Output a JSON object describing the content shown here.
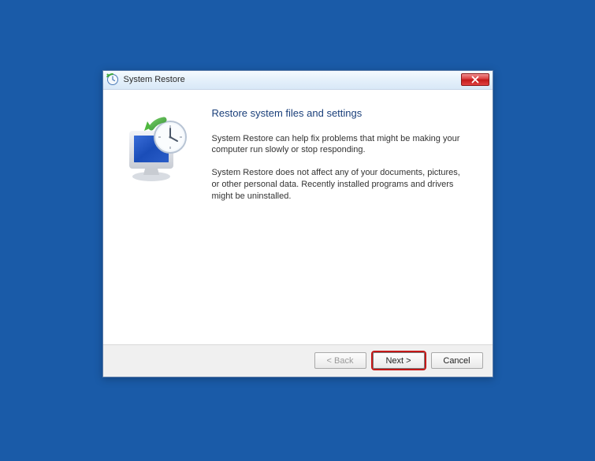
{
  "window": {
    "title": "System Restore"
  },
  "content": {
    "heading": "Restore system files and settings",
    "paragraph1": "System Restore can help fix problems that might be making your computer run slowly or stop responding.",
    "paragraph2": "System Restore does not affect any of your documents, pictures, or other personal data. Recently installed programs and drivers might be uninstalled."
  },
  "buttons": {
    "back": "< Back",
    "next": "Next >",
    "cancel": "Cancel"
  }
}
